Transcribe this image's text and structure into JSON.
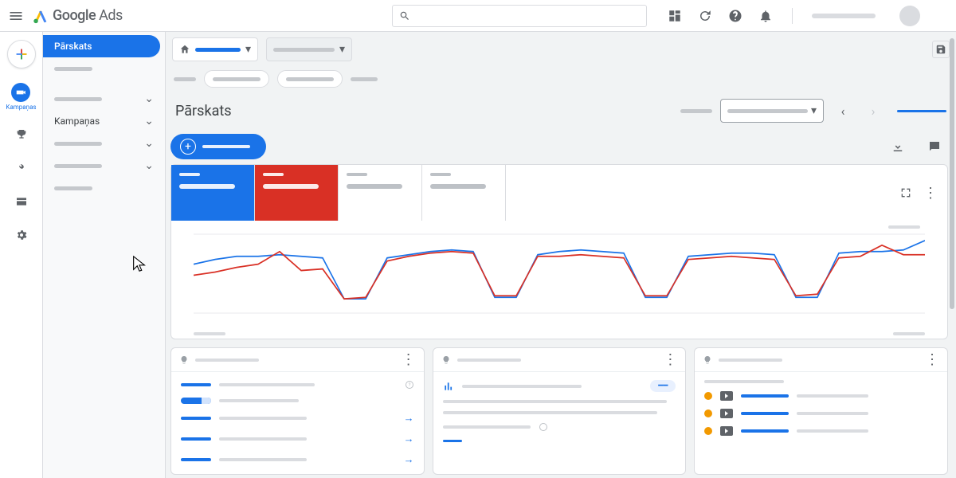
{
  "app": {
    "brand_a": "Google",
    "brand_b": "Ads"
  },
  "rail": {
    "campaigns_label": "Kampaņas"
  },
  "sidenav": {
    "overview": "Pārskats",
    "campaigns": "Kampaņas"
  },
  "page": {
    "title": "Pārskats"
  },
  "chart_data": {
    "type": "line",
    "x": [
      0,
      1,
      2,
      3,
      4,
      5,
      6,
      7,
      8,
      9,
      10,
      11,
      12,
      13,
      14,
      15,
      16,
      17,
      18,
      19,
      20,
      21,
      22,
      23,
      24,
      25,
      26,
      27,
      28,
      29,
      30,
      31,
      32,
      33,
      34
    ],
    "ylim": [
      0,
      100
    ],
    "series": [
      {
        "name": "metric-blue",
        "color": "#1a73e8",
        "values": [
          62,
          68,
          72,
          72,
          74,
          72,
          70,
          18,
          18,
          70,
          74,
          78,
          80,
          78,
          20,
          20,
          74,
          78,
          80,
          78,
          76,
          20,
          20,
          72,
          74,
          76,
          76,
          74,
          20,
          20,
          76,
          78,
          78,
          80,
          92
        ]
      },
      {
        "name": "metric-red",
        "color": "#d93025",
        "values": [
          48,
          52,
          58,
          62,
          78,
          54,
          56,
          18,
          20,
          66,
          72,
          76,
          78,
          76,
          22,
          22,
          72,
          72,
          74,
          72,
          70,
          22,
          22,
          68,
          70,
          72,
          70,
          68,
          22,
          24,
          70,
          72,
          86,
          74,
          74
        ]
      }
    ]
  }
}
